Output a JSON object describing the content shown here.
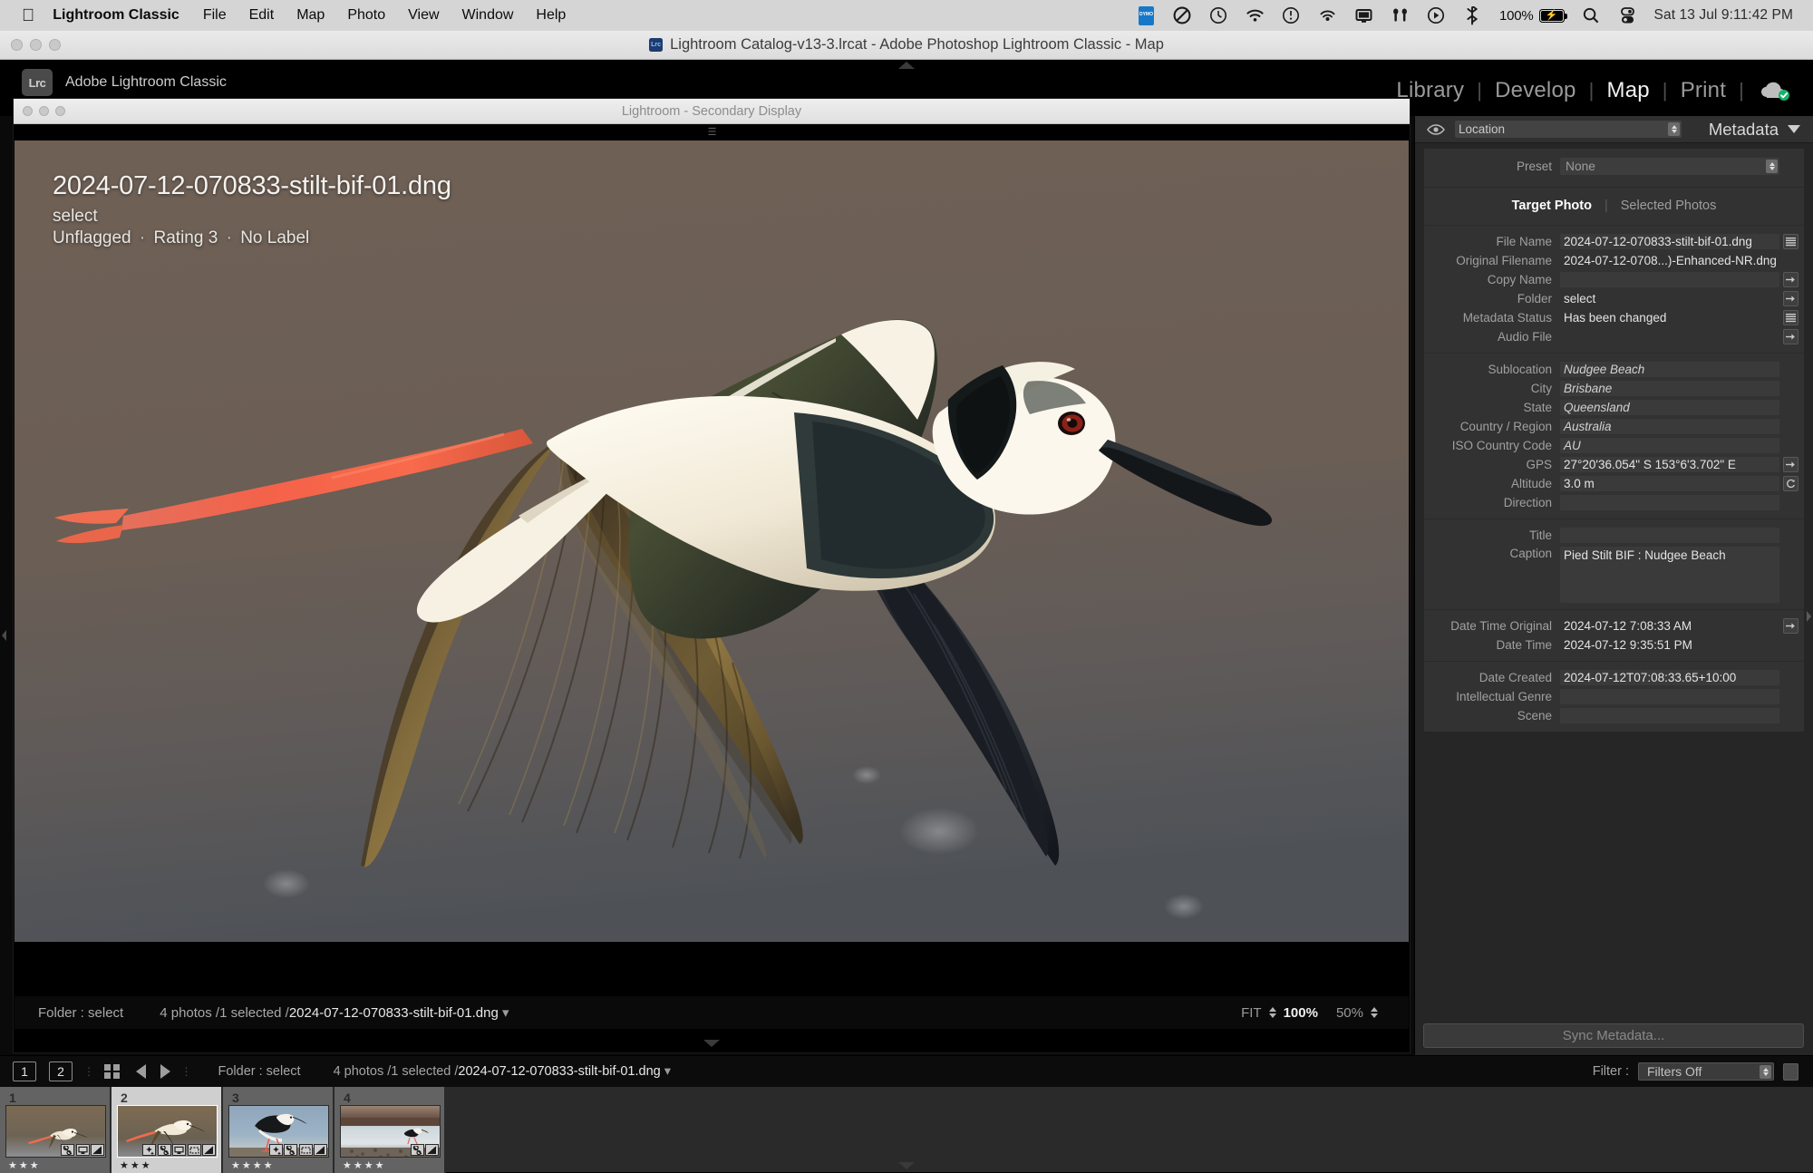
{
  "menubar": {
    "apple_glyph": "apple-logo",
    "app_name": "Lightroom Classic",
    "items": [
      "File",
      "Edit",
      "Map",
      "Photo",
      "View",
      "Window",
      "Help"
    ],
    "status_icons": [
      "dymo-icon",
      "no-entry-icon",
      "clock-icon",
      "wifi-icon",
      "alert-clock-icon",
      "airplay-audio-icon",
      "display-icon",
      "airpods-icon",
      "now-playing-icon",
      "bluetooth-icon",
      "battery-icon",
      "search-icon",
      "control-center-icon"
    ],
    "battery_percent": "100%",
    "clock": "Sat 13 Jul  9:11:42 PM"
  },
  "window": {
    "title": "Lightroom Catalog-v13-3.lrcat - Adobe Photoshop Lightroom Classic - Map",
    "app_badge": "Lrc"
  },
  "identity": {
    "logo_text": "Lrc",
    "plate_text": "Adobe Lightroom Classic"
  },
  "modules": {
    "items": [
      {
        "label": "Library",
        "active": false
      },
      {
        "label": "Develop",
        "active": false
      },
      {
        "label": "Map",
        "active": true
      },
      {
        "label": "Print",
        "active": false
      }
    ],
    "separator": "|",
    "cloud_icon": "cloud-synced-icon"
  },
  "secondary_window": {
    "title": "Lightroom - Secondary Display",
    "overlay": {
      "filename": "2024-07-12-070833-stilt-bif-01.dng",
      "folder": "select",
      "flag": "Unflagged",
      "rating": "Rating 3",
      "label": "No Label",
      "dot": "·"
    },
    "toolbar": {
      "folder_label": "Folder : select",
      "counts_prefix": "4 photos /1 selected /",
      "counts_filename": "2024-07-12-070833-stilt-bif-01.dng",
      "zoom_fit": "FIT",
      "zoom_100": "100%",
      "zoom_50": "50%"
    }
  },
  "right_panel": {
    "eye_icon": "visibility-eye-icon",
    "view_select": "Location",
    "panel_title": "Metadata",
    "collapse_icon": "triangle-down-icon",
    "preset_label": "Preset",
    "preset_value": "None",
    "tabs": [
      {
        "label": "Target Photo",
        "active": true
      },
      {
        "label": "Selected Photos",
        "active": false
      }
    ],
    "tab_separator": "|",
    "groups": [
      {
        "rows": [
          {
            "label": "File Name",
            "value": "2024-07-12-070833-stilt-bif-01.dng",
            "style": "field",
            "button": "list-icon"
          },
          {
            "label": "Original Filename",
            "value": "2024-07-12-0708...)-Enhanced-NR.dng",
            "style": "plain",
            "button": "none"
          },
          {
            "label": "Copy Name",
            "value": "",
            "style": "field",
            "button": "goto-icon"
          },
          {
            "label": "Folder",
            "value": "select",
            "style": "plain",
            "button": "goto-icon"
          },
          {
            "label": "Metadata Status",
            "value": "Has been changed",
            "style": "plain",
            "button": "list-icon"
          },
          {
            "label": "Audio File",
            "value": "",
            "style": "plain",
            "button": "goto-icon"
          }
        ]
      },
      {
        "rows": [
          {
            "label": "Sublocation",
            "value": "Nudgee Beach",
            "style": "field italic",
            "button": "none"
          },
          {
            "label": "City",
            "value": "Brisbane",
            "style": "field italic",
            "button": "none"
          },
          {
            "label": "State",
            "value": "Queensland",
            "style": "field italic",
            "button": "none"
          },
          {
            "label": "Country / Region",
            "value": "Australia",
            "style": "field italic",
            "button": "none"
          },
          {
            "label": "ISO Country Code",
            "value": "AU",
            "style": "field italic",
            "button": "none"
          },
          {
            "label": "GPS",
            "value": "27°20'36.054\" S 153°6'3.702\" E",
            "style": "field",
            "button": "goto-icon"
          },
          {
            "label": "Altitude",
            "value": "3.0 m",
            "style": "field",
            "button": "refresh-icon"
          },
          {
            "label": "Direction",
            "value": "",
            "style": "field",
            "button": "none"
          }
        ]
      },
      {
        "rows": [
          {
            "label": "Title",
            "value": "",
            "style": "field",
            "button": "none"
          }
        ],
        "caption_label": "Caption",
        "caption_value": "Pied Stilt BIF : Nudgee Beach"
      },
      {
        "rows": [
          {
            "label": "Date Time Original",
            "value": "2024-07-12 7:08:33 AM",
            "style": "plain",
            "button": "goto-icon"
          },
          {
            "label": "Date Time",
            "value": "2024-07-12 9:35:51 PM",
            "style": "plain",
            "button": "none"
          }
        ]
      },
      {
        "rows": [
          {
            "label": "Date Created",
            "value": "2024-07-12T07:08:33.65+10:00",
            "style": "field",
            "button": "none"
          },
          {
            "label": "Intellectual Genre",
            "value": "",
            "style": "field",
            "button": "none"
          },
          {
            "label": "Scene",
            "value": "",
            "style": "field",
            "button": "none"
          }
        ]
      }
    ],
    "sync_button": "Sync Metadata..."
  },
  "filmstrip": {
    "page_buttons": [
      "1",
      "2"
    ],
    "grid_icon": "grid-view-icon",
    "back_icon": "arrow-left-icon",
    "forward_icon": "arrow-right-icon",
    "folder_label": "Folder : select",
    "counts_prefix": "4 photos /1 selected /",
    "counts_filename": "2024-07-12-070833-stilt-bif-01.dng",
    "filter_label": "Filter :",
    "filter_value": "Filters Off",
    "thumbnails": [
      {
        "index": "1",
        "stars": "★★★",
        "selected": false,
        "scene": "stilt-flight-warm",
        "badges": [
          "crop-icon",
          "develop-icon",
          "adjust-icon"
        ]
      },
      {
        "index": "2",
        "stars": "★★★",
        "selected": true,
        "scene": "stilt-flight-warm-close",
        "badges": [
          "keyword-icon",
          "crop-icon",
          "develop-icon",
          "frame-icon",
          "adjust-icon"
        ]
      },
      {
        "index": "3",
        "stars": "★★★★",
        "selected": false,
        "scene": "stilt-standing-blue",
        "badges": [
          "keyword-icon",
          "crop-icon",
          "frame-icon",
          "adjust-icon"
        ]
      },
      {
        "index": "4",
        "stars": "★★★★",
        "selected": false,
        "scene": "stilt-shoreline",
        "badges": [
          "crop-icon",
          "adjust-icon"
        ]
      }
    ]
  },
  "colors": {
    "panel_bg": "#262626",
    "panel_section": "#323232",
    "field_bg": "#3a3a3a",
    "accent_text": "#e4e4e4",
    "label_text": "#a0a0a0",
    "selected_thumb": "#cfcfcf",
    "image_bg": "#6b5d4e"
  }
}
